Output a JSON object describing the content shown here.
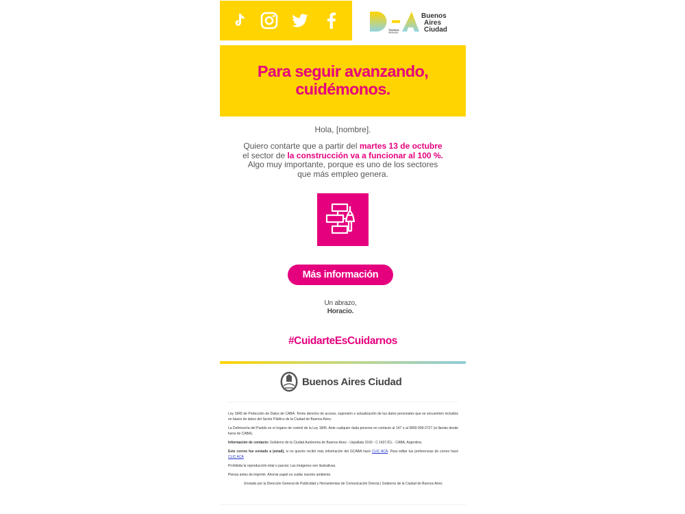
{
  "header": {
    "social": [
      {
        "icon": "tiktok-icon"
      },
      {
        "icon": "instagram-icon"
      },
      {
        "icon": "twitter-icon"
      },
      {
        "icon": "facebook-icon"
      }
    ],
    "logo": {
      "tagline_1": "Tenemos",
      "tagline_2": "distancia",
      "line1": "Buenos",
      "line2": "Aires",
      "line3": "Ciudad"
    }
  },
  "hero": {
    "line1": "Para seguir avanzando,",
    "line2": "cuidémonos."
  },
  "message": {
    "greeting": "Hola, [nombre].",
    "p1_a": "Quiero contarte que a partir del ",
    "p1_highlight": "martes 13 de octubre",
    "p2_a": "el sector de ",
    "p2_highlight": "la construcción va a funcionar al 100 %.",
    "p3": "Algo muy importante, porque es uno de los sectores",
    "p4": "que más empleo genera."
  },
  "cta": {
    "label": "Más información"
  },
  "signature": {
    "line1": "Un abrazo,",
    "line2": "Horacio."
  },
  "hashtag": "#CuidarteEsCuidarnos",
  "footer": {
    "brand": "Buenos Aires Ciudad",
    "law": "Ley 1845 de Protección de Datos de CABA: Tenés derecho de acceso, supresión o actualización de tus datos personales que se encuentren incluidos en bases de datos del Sector Público de la Ciudad de Buenos Aires.",
    "ombudsman": "La Defensoría del Pueblo es el órgano de control de la Ley 1845. Ante cualquier duda ponerse en contacto al 147 o al 0800-999-2727 (si llamás desde fuera de CABA).",
    "contact_label": "Información de contacto:",
    "contact_text": " Gobierno de la Ciudad Autónoma de Buenos Aires - Uspallata 3160 - C 1437JCL - CABA, Argentina.",
    "sent_label": "Este correo fue enviado a (email),",
    "sent_text_a": " si no querés recibir más información del GCABA hacé ",
    "link1": "CLIC ACÁ",
    "sent_text_b": ". Para editar tus preferencias de correo hacé ",
    "link2": "CLIC ACÁ",
    "prohibited": "Prohibida la reproducción total o parcial. Las imágenes son ilustrativas.",
    "print_note": "Piensa antes de imprimir. Ahorrar papel es cuidar nuestro ambiente.",
    "sent_by": "Enviado por la Dirección General de Publicidad y Herramientas de Comunicación Directa | Gobierno de la Ciudad de Buenos Aires"
  },
  "colors": {
    "yellow": "#ffd400",
    "magenta": "#e5007e"
  }
}
